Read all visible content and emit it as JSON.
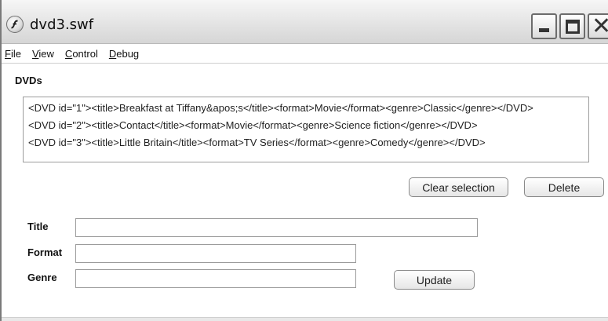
{
  "window": {
    "title": "dvd3.swf"
  },
  "menu": {
    "items": [
      {
        "label": "File",
        "mnemonic": "F",
        "rest": "ile"
      },
      {
        "label": "View",
        "mnemonic": "V",
        "rest": "iew"
      },
      {
        "label": "Control",
        "mnemonic": "C",
        "rest": "ontrol"
      },
      {
        "label": "Debug",
        "mnemonic": "D",
        "rest": "ebug"
      }
    ]
  },
  "dvds": {
    "label": "DVDs",
    "rows": [
      "<DVD id=\"1\"><title>Breakfast at Tiffany&apos;s</title><format>Movie</format><genre>Classic</genre></DVD>",
      "<DVD id=\"2\"><title>Contact</title><format>Movie</format><genre>Science fiction</genre></DVD>",
      "<DVD id=\"3\"><title>Little Britain</title><format>TV Series</format><genre>Comedy</genre></DVD>"
    ]
  },
  "buttons": {
    "clear_selection": "Clear selection",
    "delete": "Delete",
    "update": "Update"
  },
  "form": {
    "title_label": "Title",
    "title_value": "",
    "format_label": "Format",
    "format_value": "",
    "genre_label": "Genre",
    "genre_value": ""
  },
  "icons": {
    "app": "flash-player-icon",
    "minimize": "minimize-icon",
    "maximize": "maximize-icon",
    "close": "close-icon"
  }
}
